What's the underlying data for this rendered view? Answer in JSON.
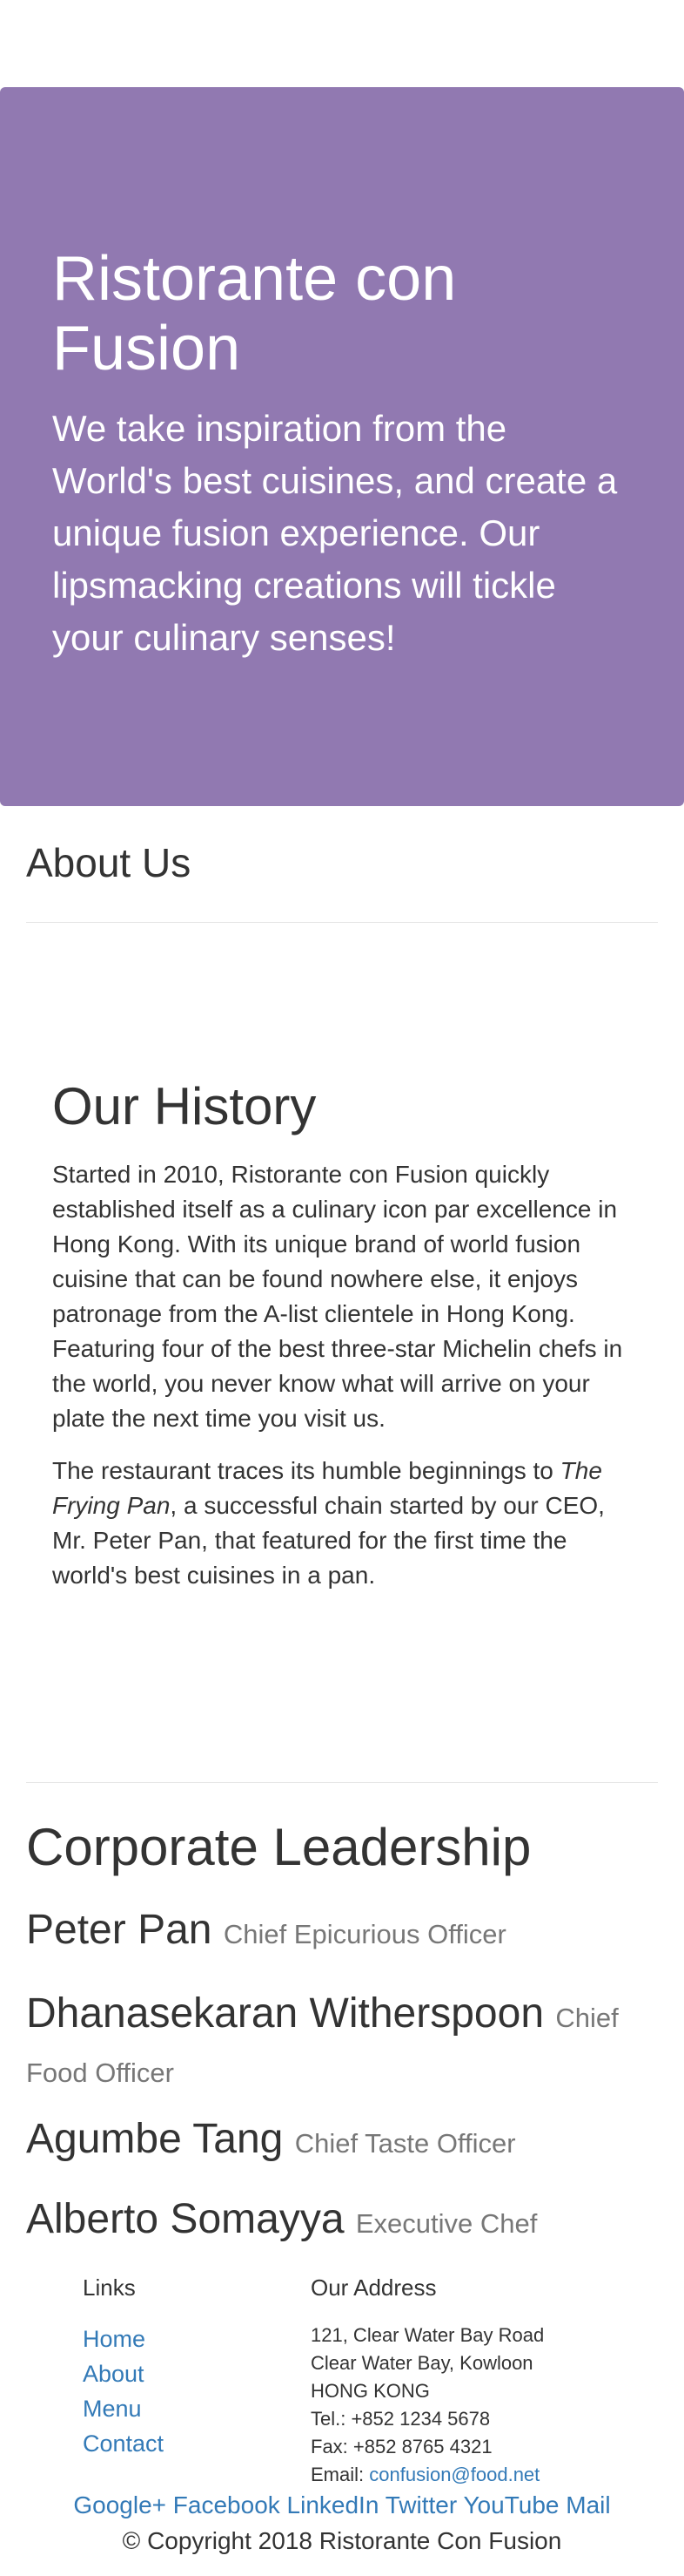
{
  "jumbotron": {
    "title": "Ristorante con Fusion",
    "tagline": "We take inspiration from the World's best cuisines, and create a unique fusion experience. Our lipsmacking creations will tickle your culinary senses!"
  },
  "page_title": "About Us",
  "history": {
    "title": "Our History",
    "paragraph1": "Started in 2010, Ristorante con Fusion quickly established itself as a culinary icon par excellence in Hong Kong. With its unique brand of world fusion cuisine that can be found nowhere else, it enjoys patronage from the A-list clientele in Hong Kong. Featuring four of the best three-star Michelin chefs in the world, you never know what will arrive on your plate the next time you visit us.",
    "paragraph2_before": "The restaurant traces its humble beginnings to ",
    "paragraph2_italic": "The Frying Pan",
    "paragraph2_after": ", a successful chain started by our CEO, Mr. Peter Pan, that featured for the first time the world's best cuisines in a pan."
  },
  "leadership": {
    "title": "Corporate Leadership",
    "leaders": [
      {
        "name": "Peter Pan",
        "role": "Chief Epicurious Officer"
      },
      {
        "name": "Dhanasekaran Witherspoon",
        "role": "Chief Food Officer"
      },
      {
        "name": "Agumbe Tang",
        "role": "Chief Taste Officer"
      },
      {
        "name": "Alberto Somayya",
        "role": "Executive Chef"
      }
    ]
  },
  "footer": {
    "links_title": "Links",
    "links": [
      "Home",
      "About",
      "Menu",
      "Contact"
    ],
    "address_title": "Our Address",
    "address_lines": [
      "121, Clear Water Bay Road",
      "Clear Water Bay, Kowloon",
      "HONG KONG"
    ],
    "tel": "Tel.: +852 1234 5678",
    "fax": "Fax: +852 8765 4321",
    "email_label": "Email: ",
    "email": "confusion@food.net",
    "social": [
      "Google+",
      "Facebook",
      "LinkedIn",
      "Twitter",
      "YouTube",
      "Mail"
    ],
    "copyright": "© Copyright 2018 Ristorante Con Fusion"
  },
  "colors": {
    "jumbotron_bg": "#9179b1",
    "link": "#337ab7",
    "muted": "#777777"
  }
}
